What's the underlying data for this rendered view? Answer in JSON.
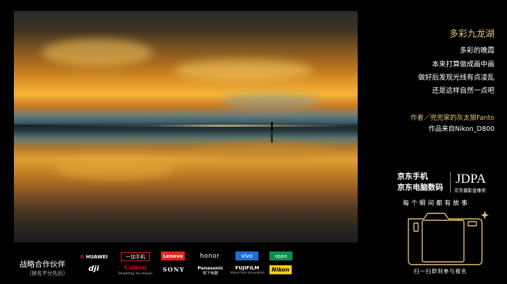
{
  "photo": {
    "subject_icon": "person-silhouette"
  },
  "caption": {
    "title": "多彩九龙湖",
    "lines": [
      "多彩的晚霞",
      "本来打算做成画中画",
      "做好后发现光线有点凌乱",
      "还是这样自然一点吧"
    ],
    "author": "作者／兜兜家的灰太狼Fanto",
    "source": "作品来自Nikon_D800"
  },
  "brand": {
    "jd_phone": "京东手机",
    "jd_computer": "京东电脑数码",
    "jdpa_logo_text": "JDPA",
    "jdpa_award": "京东摄影金像奖",
    "slogan": "每个瞬间都有故事",
    "scan_prompt": "扫一扫即刻参与报名",
    "accent_color": "#e7c27b"
  },
  "partners": {
    "title": "战略合作伙伴",
    "note": "（排名不分先后）",
    "logos": {
      "huawei": "HUAWEI",
      "oneplus": "一加手机",
      "lenovo": "Lenovo",
      "honor": "honor",
      "vivo": "vivo",
      "oppo": "oppo",
      "dji": "dji",
      "canon": "Canon",
      "canon_sub": "Delighting You Always",
      "sony": "SONY",
      "panasonic": "Panasonic",
      "panasonic_sub": "松下电器",
      "fujifilm": "FUJIFILM",
      "fujifilm_sub": "Value from Innovation",
      "nikon": "Nikon"
    }
  }
}
